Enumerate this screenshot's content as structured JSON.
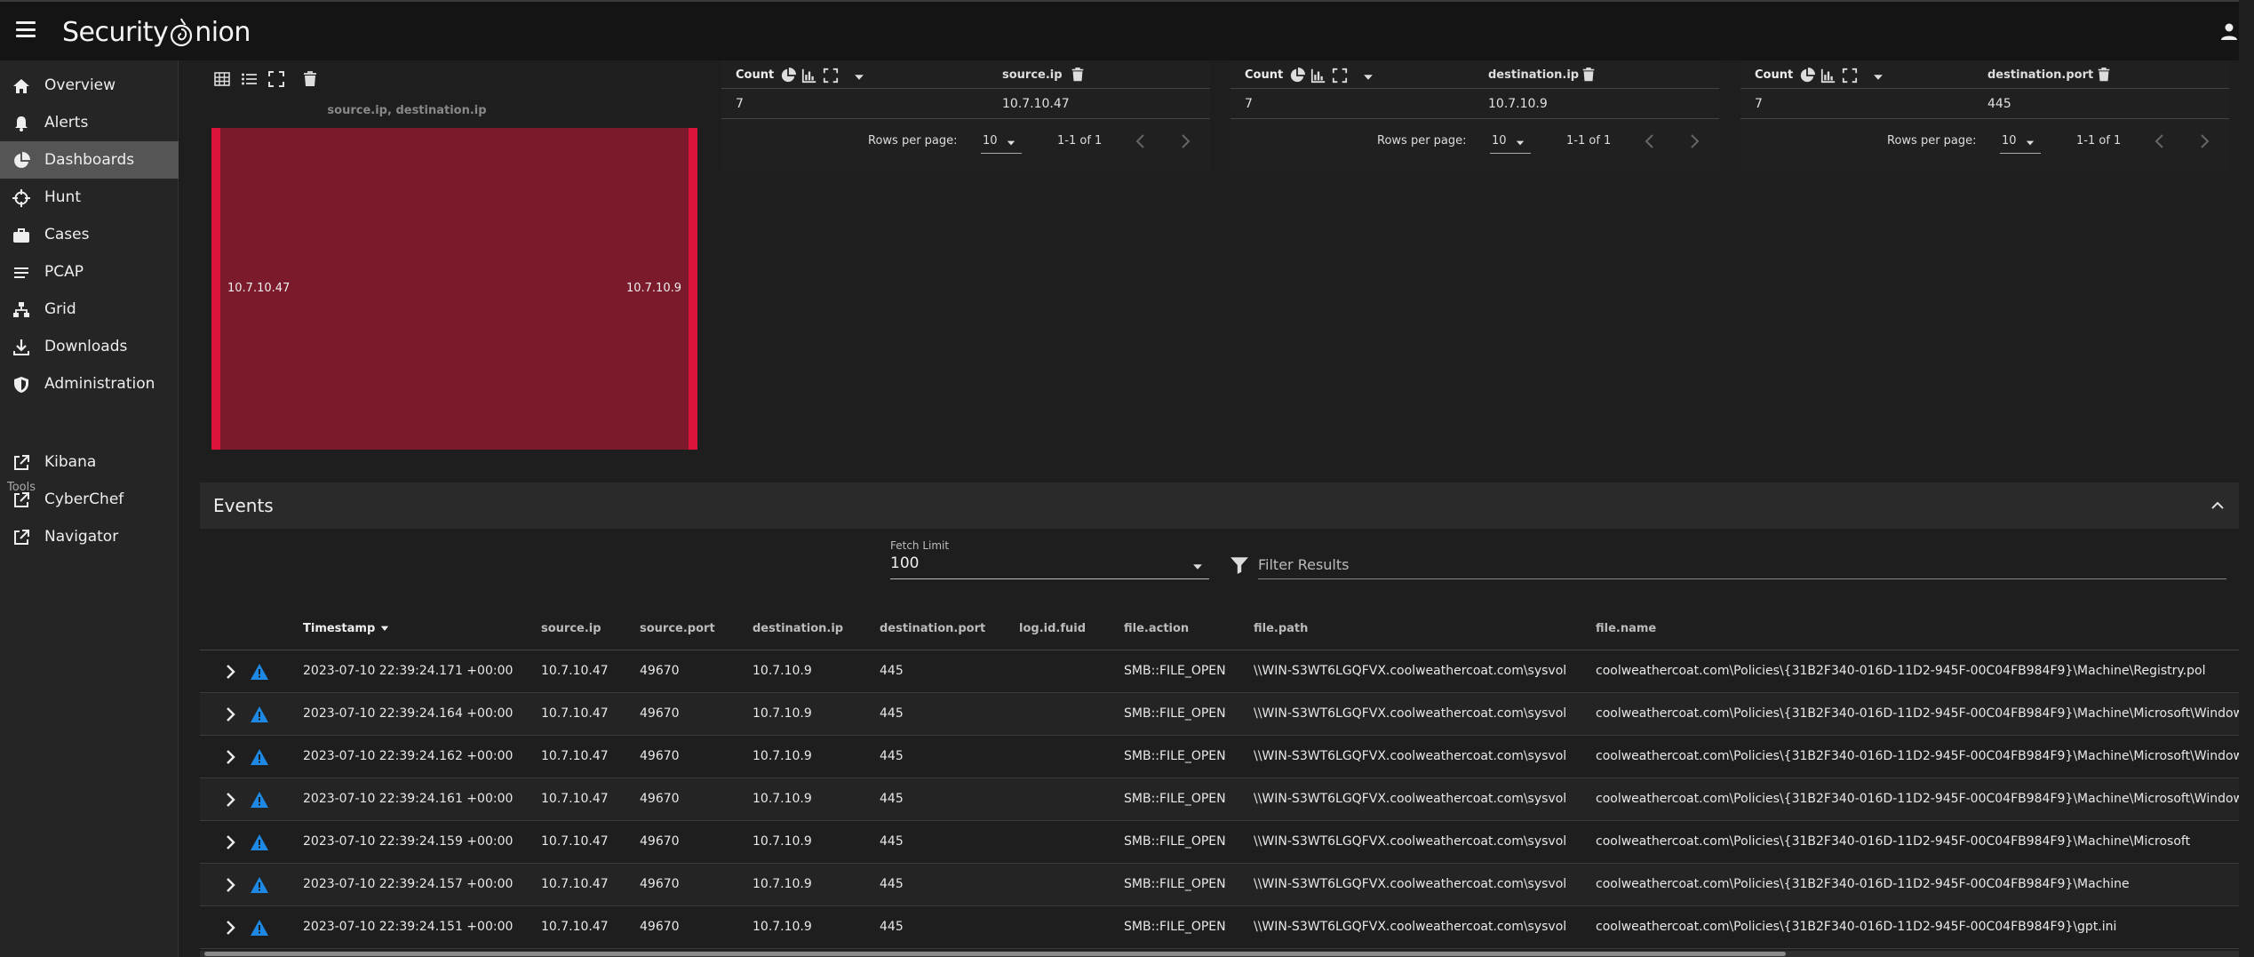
{
  "app": {
    "logo_text_1": "Security",
    "logo_text_2": "nion"
  },
  "sidebar": {
    "items": [
      {
        "label": "Overview"
      },
      {
        "label": "Alerts"
      },
      {
        "label": "Dashboards"
      },
      {
        "label": "Hunt"
      },
      {
        "label": "Cases"
      },
      {
        "label": "PCAP"
      },
      {
        "label": "Grid"
      },
      {
        "label": "Downloads"
      },
      {
        "label": "Administration"
      }
    ],
    "tools_label": "Tools",
    "tools": [
      {
        "label": "Kibana"
      },
      {
        "label": "CyberChef"
      },
      {
        "label": "Navigator"
      }
    ]
  },
  "sankey": {
    "title": "source.ip, destination.ip",
    "left_label": "10.7.10.47",
    "right_label": "10.7.10.9",
    "color": "#7a1a2b",
    "node_color": "#dc143c"
  },
  "cards": [
    {
      "count_label": "Count",
      "field": "source.ip",
      "count": "7",
      "value": "10.7.10.47",
      "rows_per_page_label": "Rows per page:",
      "rows_per_page": "10",
      "range": "1-1 of 1"
    },
    {
      "count_label": "Count",
      "field": "destination.ip",
      "count": "7",
      "value": "10.7.10.9",
      "rows_per_page_label": "Rows per page:",
      "rows_per_page": "10",
      "range": "1-1 of 1"
    },
    {
      "count_label": "Count",
      "field": "destination.port",
      "count": "7",
      "value": "445",
      "rows_per_page_label": "Rows per page:",
      "rows_per_page": "10",
      "range": "1-1 of 1"
    }
  ],
  "events": {
    "title": "Events",
    "fetch_limit_label": "Fetch Limit",
    "fetch_limit": "100",
    "filter_placeholder": "Filter Results",
    "columns": [
      "Timestamp",
      "source.ip",
      "source.port",
      "destination.ip",
      "destination.port",
      "log.id.fuid",
      "file.action",
      "file.path",
      "file.name"
    ],
    "rows": [
      [
        "2023-07-10 22:39:24.171 +00:00",
        "10.7.10.47",
        "49670",
        "10.7.10.9",
        "445",
        "",
        "SMB::FILE_OPEN",
        "\\\\WIN-S3WT6LGQFVX.coolweathercoat.com\\sysvol",
        "coolweathercoat.com\\Policies\\{31B2F340-016D-11D2-945F-00C04FB984F9}\\Machine\\Registry.pol"
      ],
      [
        "2023-07-10 22:39:24.164 +00:00",
        "10.7.10.47",
        "49670",
        "10.7.10.9",
        "445",
        "",
        "SMB::FILE_OPEN",
        "\\\\WIN-S3WT6LGQFVX.coolweathercoat.com\\sysvol",
        "coolweathercoat.com\\Policies\\{31B2F340-016D-11D2-945F-00C04FB984F9}\\Machine\\Microsoft\\Window"
      ],
      [
        "2023-07-10 22:39:24.162 +00:00",
        "10.7.10.47",
        "49670",
        "10.7.10.9",
        "445",
        "",
        "SMB::FILE_OPEN",
        "\\\\WIN-S3WT6LGQFVX.coolweathercoat.com\\sysvol",
        "coolweathercoat.com\\Policies\\{31B2F340-016D-11D2-945F-00C04FB984F9}\\Machine\\Microsoft\\Window"
      ],
      [
        "2023-07-10 22:39:24.161 +00:00",
        "10.7.10.47",
        "49670",
        "10.7.10.9",
        "445",
        "",
        "SMB::FILE_OPEN",
        "\\\\WIN-S3WT6LGQFVX.coolweathercoat.com\\sysvol",
        "coolweathercoat.com\\Policies\\{31B2F340-016D-11D2-945F-00C04FB984F9}\\Machine\\Microsoft\\Window"
      ],
      [
        "2023-07-10 22:39:24.159 +00:00",
        "10.7.10.47",
        "49670",
        "10.7.10.9",
        "445",
        "",
        "SMB::FILE_OPEN",
        "\\\\WIN-S3WT6LGQFVX.coolweathercoat.com\\sysvol",
        "coolweathercoat.com\\Policies\\{31B2F340-016D-11D2-945F-00C04FB984F9}\\Machine\\Microsoft"
      ],
      [
        "2023-07-10 22:39:24.157 +00:00",
        "10.7.10.47",
        "49670",
        "10.7.10.9",
        "445",
        "",
        "SMB::FILE_OPEN",
        "\\\\WIN-S3WT6LGQFVX.coolweathercoat.com\\sysvol",
        "coolweathercoat.com\\Policies\\{31B2F340-016D-11D2-945F-00C04FB984F9}\\Machine"
      ],
      [
        "2023-07-10 22:39:24.151 +00:00",
        "10.7.10.47",
        "49670",
        "10.7.10.9",
        "445",
        "",
        "SMB::FILE_OPEN",
        "\\\\WIN-S3WT6LGQFVX.coolweathercoat.com\\sysvol",
        "coolweathercoat.com\\Policies\\{31B2F340-016D-11D2-945F-00C04FB984F9}\\gpt.ini"
      ]
    ]
  },
  "colors": {
    "warning_icon": "#1e88e5",
    "active_nav": "#555555"
  }
}
